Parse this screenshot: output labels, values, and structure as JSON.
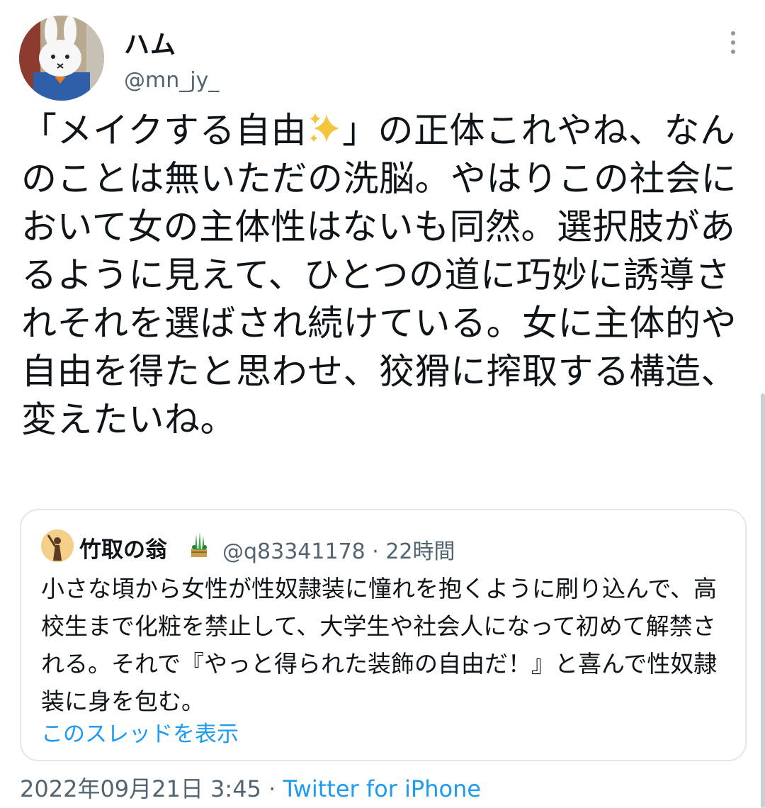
{
  "tweet": {
    "author": {
      "display_name": "ハム",
      "handle": "@mn_jy_"
    },
    "text_parts": {
      "before_emoji": "「メイクする自由",
      "after_emoji": "」の正体これやね、なんのことは無いただの洗脳。やはりこの社会において女の主体性はないも同然。選択肢があるように見えて、ひとつの道に巧妙に誘導されそれを選ばされ続けている。女に主体的や自由を得たと思わせ、狡猾に搾取する構造、変えたいね。"
    },
    "emoji": "sparkles-icon",
    "timestamp": "2022年09月21日 3:45",
    "separator": "·",
    "source": "Twitter for iPhone"
  },
  "quote": {
    "author": {
      "display_name": "竹取の翁",
      "badge_icon": "kadomatsu-icon",
      "meta": "@q83341178 · 22時間"
    },
    "text": "小さな頃から女性が性奴隷装に憧れを抱くように刷り込んで、高校生まで化粧を禁止して、大学生や社会人になって初めて解禁される。それで『やっと得られた装飾の自由だ！』と喜んで性奴隷装に身を包む。",
    "show_thread_label": "このスレッドを表示"
  },
  "colors": {
    "text": "#0f1419",
    "secondary": "#536471",
    "link": "#1d9bf0",
    "border": "#e1e8ed"
  }
}
